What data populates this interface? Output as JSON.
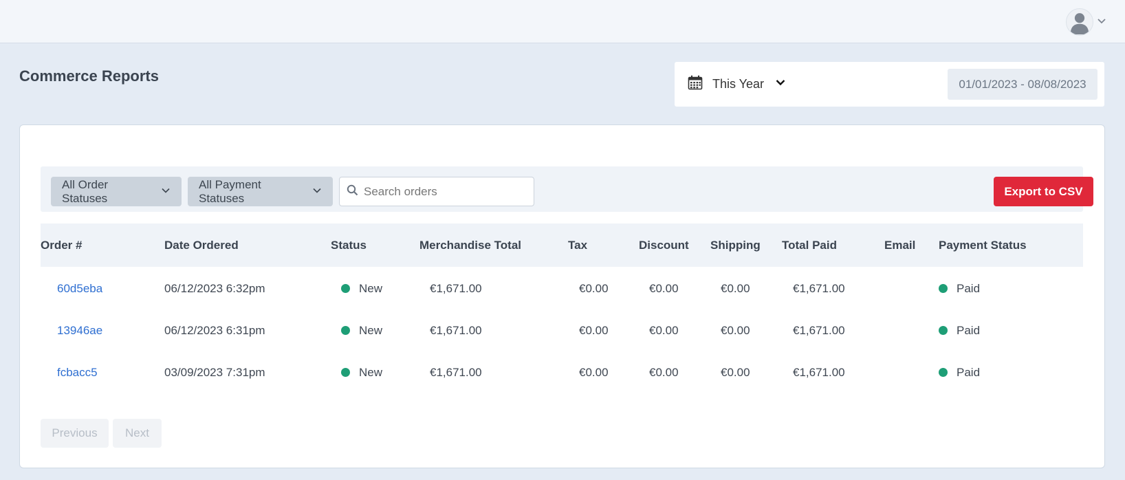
{
  "header": {
    "user_menu": {
      "avatar_icon": "user-avatar-icon",
      "chevron_icon": "chevron-down-icon"
    }
  },
  "page": {
    "title": "Commerce Reports"
  },
  "date_filter": {
    "calendar_icon": "calendar-icon",
    "preset_label": "This Year",
    "range": "01/01/2023 - 08/08/2023"
  },
  "filters": {
    "order_status_label": "All Order Statuses",
    "payment_status_label": "All Payment Statuses",
    "search_placeholder": "Search orders",
    "export_label": "Export to CSV"
  },
  "table": {
    "headers": {
      "order": "Order #",
      "date": "Date Ordered",
      "status": "Status",
      "merch": "Merchandise Total",
      "tax": "Tax",
      "discount": "Discount",
      "shipping": "Shipping",
      "total": "Total Paid",
      "email": "Email",
      "payment": "Payment Status"
    },
    "rows": [
      {
        "order": "60d5eba",
        "date": "06/12/2023 6:32pm",
        "status": "New",
        "merch": "€1,671.00",
        "tax": "€0.00",
        "discount": "€0.00",
        "shipping": "€0.00",
        "total": "€1,671.00",
        "email": "",
        "payment": "Paid"
      },
      {
        "order": "13946ae",
        "date": "06/12/2023 6:31pm",
        "status": "New",
        "merch": "€1,671.00",
        "tax": "€0.00",
        "discount": "€0.00",
        "shipping": "€0.00",
        "total": "€1,671.00",
        "email": "",
        "payment": "Paid"
      },
      {
        "order": "fcbacc5",
        "date": "03/09/2023 7:31pm",
        "status": "New",
        "merch": "€1,671.00",
        "tax": "€0.00",
        "discount": "€0.00",
        "shipping": "€0.00",
        "total": "€1,671.00",
        "email": "",
        "payment": "Paid"
      }
    ]
  },
  "pagination": {
    "previous_label": "Previous",
    "next_label": "Next"
  },
  "colors": {
    "accent_red": "#e0283a",
    "link_blue": "#2f6fd1",
    "status_green": "#1e9e76",
    "page_bg": "#e4ebf4"
  }
}
